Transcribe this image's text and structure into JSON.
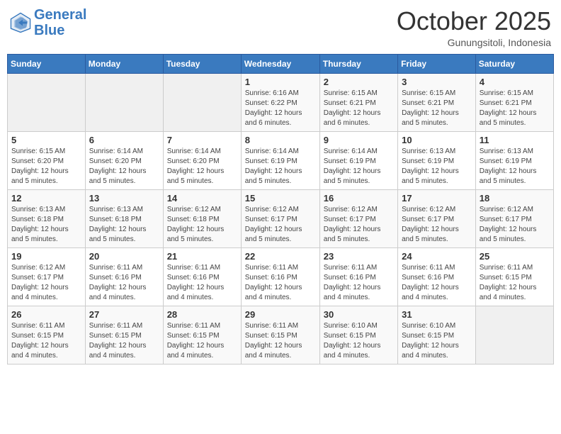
{
  "header": {
    "logo_line1": "General",
    "logo_line2": "Blue",
    "month": "October 2025",
    "location": "Gunungsitoli, Indonesia"
  },
  "weekdays": [
    "Sunday",
    "Monday",
    "Tuesday",
    "Wednesday",
    "Thursday",
    "Friday",
    "Saturday"
  ],
  "weeks": [
    [
      {
        "day": "",
        "info": ""
      },
      {
        "day": "",
        "info": ""
      },
      {
        "day": "",
        "info": ""
      },
      {
        "day": "1",
        "info": "Sunrise: 6:16 AM\nSunset: 6:22 PM\nDaylight: 12 hours\nand 6 minutes."
      },
      {
        "day": "2",
        "info": "Sunrise: 6:15 AM\nSunset: 6:21 PM\nDaylight: 12 hours\nand 6 minutes."
      },
      {
        "day": "3",
        "info": "Sunrise: 6:15 AM\nSunset: 6:21 PM\nDaylight: 12 hours\nand 5 minutes."
      },
      {
        "day": "4",
        "info": "Sunrise: 6:15 AM\nSunset: 6:21 PM\nDaylight: 12 hours\nand 5 minutes."
      }
    ],
    [
      {
        "day": "5",
        "info": "Sunrise: 6:15 AM\nSunset: 6:20 PM\nDaylight: 12 hours\nand 5 minutes."
      },
      {
        "day": "6",
        "info": "Sunrise: 6:14 AM\nSunset: 6:20 PM\nDaylight: 12 hours\nand 5 minutes."
      },
      {
        "day": "7",
        "info": "Sunrise: 6:14 AM\nSunset: 6:20 PM\nDaylight: 12 hours\nand 5 minutes."
      },
      {
        "day": "8",
        "info": "Sunrise: 6:14 AM\nSunset: 6:19 PM\nDaylight: 12 hours\nand 5 minutes."
      },
      {
        "day": "9",
        "info": "Sunrise: 6:14 AM\nSunset: 6:19 PM\nDaylight: 12 hours\nand 5 minutes."
      },
      {
        "day": "10",
        "info": "Sunrise: 6:13 AM\nSunset: 6:19 PM\nDaylight: 12 hours\nand 5 minutes."
      },
      {
        "day": "11",
        "info": "Sunrise: 6:13 AM\nSunset: 6:19 PM\nDaylight: 12 hours\nand 5 minutes."
      }
    ],
    [
      {
        "day": "12",
        "info": "Sunrise: 6:13 AM\nSunset: 6:18 PM\nDaylight: 12 hours\nand 5 minutes."
      },
      {
        "day": "13",
        "info": "Sunrise: 6:13 AM\nSunset: 6:18 PM\nDaylight: 12 hours\nand 5 minutes."
      },
      {
        "day": "14",
        "info": "Sunrise: 6:12 AM\nSunset: 6:18 PM\nDaylight: 12 hours\nand 5 minutes."
      },
      {
        "day": "15",
        "info": "Sunrise: 6:12 AM\nSunset: 6:17 PM\nDaylight: 12 hours\nand 5 minutes."
      },
      {
        "day": "16",
        "info": "Sunrise: 6:12 AM\nSunset: 6:17 PM\nDaylight: 12 hours\nand 5 minutes."
      },
      {
        "day": "17",
        "info": "Sunrise: 6:12 AM\nSunset: 6:17 PM\nDaylight: 12 hours\nand 5 minutes."
      },
      {
        "day": "18",
        "info": "Sunrise: 6:12 AM\nSunset: 6:17 PM\nDaylight: 12 hours\nand 5 minutes."
      }
    ],
    [
      {
        "day": "19",
        "info": "Sunrise: 6:12 AM\nSunset: 6:17 PM\nDaylight: 12 hours\nand 4 minutes."
      },
      {
        "day": "20",
        "info": "Sunrise: 6:11 AM\nSunset: 6:16 PM\nDaylight: 12 hours\nand 4 minutes."
      },
      {
        "day": "21",
        "info": "Sunrise: 6:11 AM\nSunset: 6:16 PM\nDaylight: 12 hours\nand 4 minutes."
      },
      {
        "day": "22",
        "info": "Sunrise: 6:11 AM\nSunset: 6:16 PM\nDaylight: 12 hours\nand 4 minutes."
      },
      {
        "day": "23",
        "info": "Sunrise: 6:11 AM\nSunset: 6:16 PM\nDaylight: 12 hours\nand 4 minutes."
      },
      {
        "day": "24",
        "info": "Sunrise: 6:11 AM\nSunset: 6:16 PM\nDaylight: 12 hours\nand 4 minutes."
      },
      {
        "day": "25",
        "info": "Sunrise: 6:11 AM\nSunset: 6:15 PM\nDaylight: 12 hours\nand 4 minutes."
      }
    ],
    [
      {
        "day": "26",
        "info": "Sunrise: 6:11 AM\nSunset: 6:15 PM\nDaylight: 12 hours\nand 4 minutes."
      },
      {
        "day": "27",
        "info": "Sunrise: 6:11 AM\nSunset: 6:15 PM\nDaylight: 12 hours\nand 4 minutes."
      },
      {
        "day": "28",
        "info": "Sunrise: 6:11 AM\nSunset: 6:15 PM\nDaylight: 12 hours\nand 4 minutes."
      },
      {
        "day": "29",
        "info": "Sunrise: 6:11 AM\nSunset: 6:15 PM\nDaylight: 12 hours\nand 4 minutes."
      },
      {
        "day": "30",
        "info": "Sunrise: 6:10 AM\nSunset: 6:15 PM\nDaylight: 12 hours\nand 4 minutes."
      },
      {
        "day": "31",
        "info": "Sunrise: 6:10 AM\nSunset: 6:15 PM\nDaylight: 12 hours\nand 4 minutes."
      },
      {
        "day": "",
        "info": ""
      }
    ]
  ]
}
